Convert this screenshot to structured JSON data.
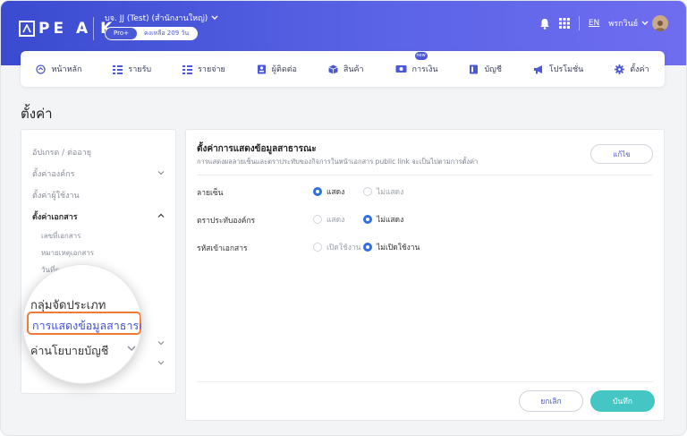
{
  "header": {
    "logo_text": "PE A K",
    "company": "บจ. JJ (Test) (สำนักงานใหญ่)",
    "plan_badge": "Pro+",
    "plan_remaining": "คงเหลือ 209 วัน",
    "language": "EN",
    "user": "พรกวินย์"
  },
  "nav": {
    "items": [
      {
        "label": "หน้าหลัก",
        "icon": "home-icon"
      },
      {
        "label": "รายรับ",
        "icon": "receipt-icon"
      },
      {
        "label": "รายจ่าย",
        "icon": "expense-icon"
      },
      {
        "label": "ผู้ติดต่อ",
        "icon": "contact-icon"
      },
      {
        "label": "สินค้า",
        "icon": "box-icon"
      },
      {
        "label": "การเงิน",
        "icon": "money-icon",
        "badge": "new"
      },
      {
        "label": "บัญชี",
        "icon": "ledger-icon"
      },
      {
        "label": "โปรโมชั่น",
        "icon": "megaphone-icon"
      },
      {
        "label": "ตั้งค่า",
        "icon": "gear-icon"
      }
    ]
  },
  "page": {
    "title": "ตั้งค่า"
  },
  "sidebar": {
    "items": [
      {
        "label": "อัปเกรด / ต่ออายุ"
      },
      {
        "label": "ตั้งค่าองค์กร"
      },
      {
        "label": "ตั้งค่าผู้ใช้งาน"
      },
      {
        "label": "ตั้งค่าเอกสาร"
      }
    ],
    "subitems": [
      {
        "label": "เลขที่เอกสาร"
      },
      {
        "label": "หมายเหตุเอกสาร"
      },
      {
        "label": "วันที่ตามเอ"
      }
    ]
  },
  "magnifier": {
    "item1": "กลุ่มจัดประเภท",
    "item2": "การแสดงข้อมูลสาธารณะ",
    "item3": "ค่านโยบายบัญชี"
  },
  "panel": {
    "title": "ตั้งค่าการแสดงข้อมูลสาธารณะ",
    "description": "การแสดงผลลายเซ็นและตราประทับของกิจการในหน้าเอกสาร public link จะเป็นไปตามการตั้งค่า",
    "edit_label": "แก้ไข",
    "rows": [
      {
        "label": "ลายเซ็น",
        "option_a": "แสดง",
        "option_b": "ไม่แสดง",
        "selected": "a"
      },
      {
        "label": "ตราประทับองค์กร",
        "option_a": "แสดง",
        "option_b": "ไม่แสดง",
        "selected": "b"
      },
      {
        "label": "รหัสเข้าเอกสาร",
        "option_a": "เปิดใช้งาน",
        "option_b": "ไม่เปิดใช้งาน",
        "selected": "b"
      }
    ],
    "cancel_label": "ยกเลิก",
    "save_label": "บันทึก"
  },
  "colors": {
    "header_start": "#3a4bcf",
    "header_end": "#6f6df0",
    "accent": "#4b59d8",
    "save": "#43c6c4",
    "highlight": "#ef7b3b",
    "radio_selected": "#2f6fe3"
  }
}
